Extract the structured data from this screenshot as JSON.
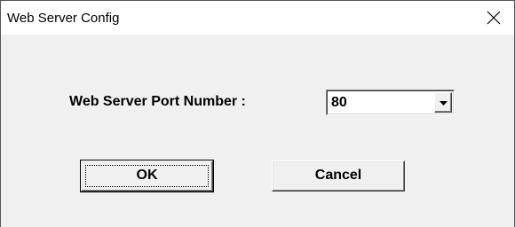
{
  "window": {
    "title": "Web Server Config",
    "close_icon": "close-icon"
  },
  "form": {
    "port_label": "Web Server Port Number :",
    "port_value": "80",
    "dropdown_icon": "chevron-down-icon"
  },
  "buttons": {
    "ok_label": "OK",
    "cancel_label": "Cancel"
  },
  "colors": {
    "dialog_background": "#f0f0f0",
    "titlebar_background": "#ffffff"
  }
}
